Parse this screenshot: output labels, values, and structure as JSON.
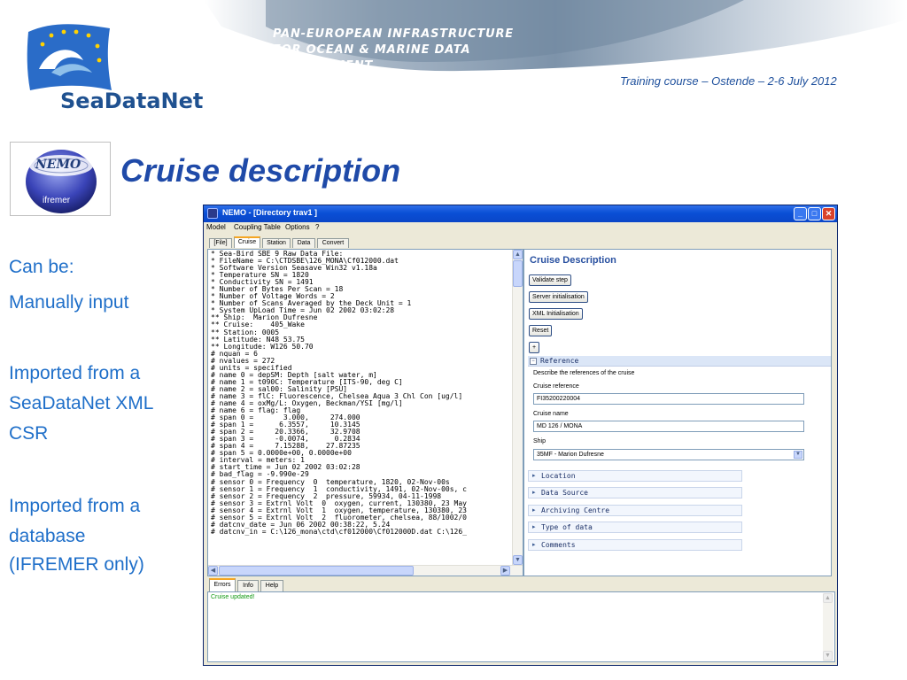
{
  "header": {
    "logo_text": "SeaDataNet",
    "banner_lines": [
      "PAN-EUROPEAN INFRASTRUCTURE",
      "FOR OCEAN & MARINE DATA",
      "MANAGEMENT"
    ],
    "training_course": "Training course – Ostende – 2-6 July 2012"
  },
  "nemo_logo": {
    "word": "NEMO",
    "sub": "ifremer"
  },
  "slide_title": "Cruise description",
  "left_text": {
    "can_be": "Can be:",
    "manually": "Manually input",
    "imported_xml": [
      "Imported from a",
      "SeaDataNet XML",
      "CSR"
    ],
    "imported_db": [
      "Imported from a",
      "database",
      "(IFREMER only)"
    ]
  },
  "app": {
    "window_title": "NEMO - [Directory trav1 ]",
    "menu": [
      "Model",
      "Coupling Table",
      "Options",
      "?"
    ],
    "tabs": [
      "[File]",
      "Cruise",
      "Station",
      "Data",
      "Convert"
    ],
    "active_tab": "Cruise",
    "raw_text_lines": [
      "* Sea-Bird SBE 9 Raw Data File:",
      "* FileName = C:\\CTDSBE\\126_MONA\\Cf012000.dat",
      "* Software Version Seasave Win32 v1.18a",
      "* Temperature SN = 1820",
      "* Conductivity SN = 1491",
      "* Number of Bytes Per Scan = 18",
      "* Number of Voltage Words = 2",
      "* Number of Scans Averaged by the Deck Unit = 1",
      "* System UpLoad Time = Jun 02 2002 03:02:28",
      "** Ship:  Marion Dufresne",
      "** Cruise:    405_Wake",
      "** Station: 0005",
      "** Latitude: N48 53.75",
      "** Longitude: W126 50.70",
      "# nquan = 6",
      "# nvalues = 272",
      "# units = specified",
      "# name 0 = depSM: Depth [salt water, m]",
      "# name 1 = t090C: Temperature [ITS-90, deg C]",
      "# name 2 = sal00: Salinity [PSU]",
      "# name 3 = flC: Fluorescence, Chelsea Aqua 3 Chl Con [ug/l]",
      "# name 4 = oxMg/L: Oxygen, Beckman/YSI [mg/l]",
      "# name 6 = flag: flag",
      "# span 0 =       3.000,     274.000",
      "# span 1 =      6.3557,     10.3145",
      "# span 2 =     20.3366,     32.9708",
      "# span 3 =     -0.0074,      0.2834",
      "# span 4 =     7.15288,    27.87235",
      "# span 5 = 0.0000e+00, 0.0000e+00",
      "# interval = meters: 1",
      "# start_time = Jun 02 2002 03:02:28",
      "# bad_flag = -9.990e-29",
      "# sensor 0 = Frequency  0  temperature, 1820, 02-Nov-00s",
      "# sensor 1 = Frequency  1  conductivity, 1491, 02-Nov-00s, c",
      "# sensor 2 = Frequency  2  pressure, 59934, 04-11-1998",
      "# sensor 3 = Extrnl Volt  0  oxygen, current, 130380, 23 May",
      "# sensor 4 = Extrnl Volt  1  oxygen, temperature, 130380, 23",
      "# sensor 5 = Extrnl Volt  2  fluorometer, chelsea, 88/1002/0",
      "# datcnv_date = Jun 06 2002 00:38:22, 5.24",
      "# datcnv_in = C:\\126_mona\\ctd\\cf012000\\Cf012000D.dat C:\\126_"
    ],
    "right": {
      "title": "Cruise Description",
      "buttons": [
        "Validate step",
        "Server initialisation",
        "XML Initialisation",
        "Reset",
        "+"
      ],
      "reference": {
        "toggle": "−",
        "header": "Reference",
        "describe": "Describe the references of the cruise",
        "cruise_reference_label": "Cruise reference",
        "cruise_reference_value": "FI35200220004",
        "cruise_name_label": "Cruise name",
        "cruise_name_value": "MD 126 / MONA",
        "ship_label": "Ship",
        "ship_value": "35MF - Marion Dufresne"
      },
      "sections": [
        "Location",
        "Data Source",
        "Archiving Centre",
        "Type of data",
        "Comments"
      ]
    },
    "bottom_tabs": [
      "Errors",
      "Info",
      "Help"
    ],
    "active_bottom_tab": "Errors",
    "log_message": "Cruise updated!"
  },
  "colors": {
    "title_blue": "#1f4aa8",
    "left_text_blue": "#1f6fc9",
    "xp_titlebar": "#0a4fd6",
    "log_green": "#139a13"
  },
  "icons": [
    "sea-wave-flag-icon",
    "nemo-globe-icon",
    "app-window-icon",
    "minimize-icon",
    "maximize-icon",
    "close-icon",
    "scroll-up-icon",
    "scroll-down-icon",
    "scroll-left-icon",
    "scroll-right-icon",
    "collapse-icon",
    "expand-arrow-icon",
    "dropdown-arrow-icon"
  ]
}
